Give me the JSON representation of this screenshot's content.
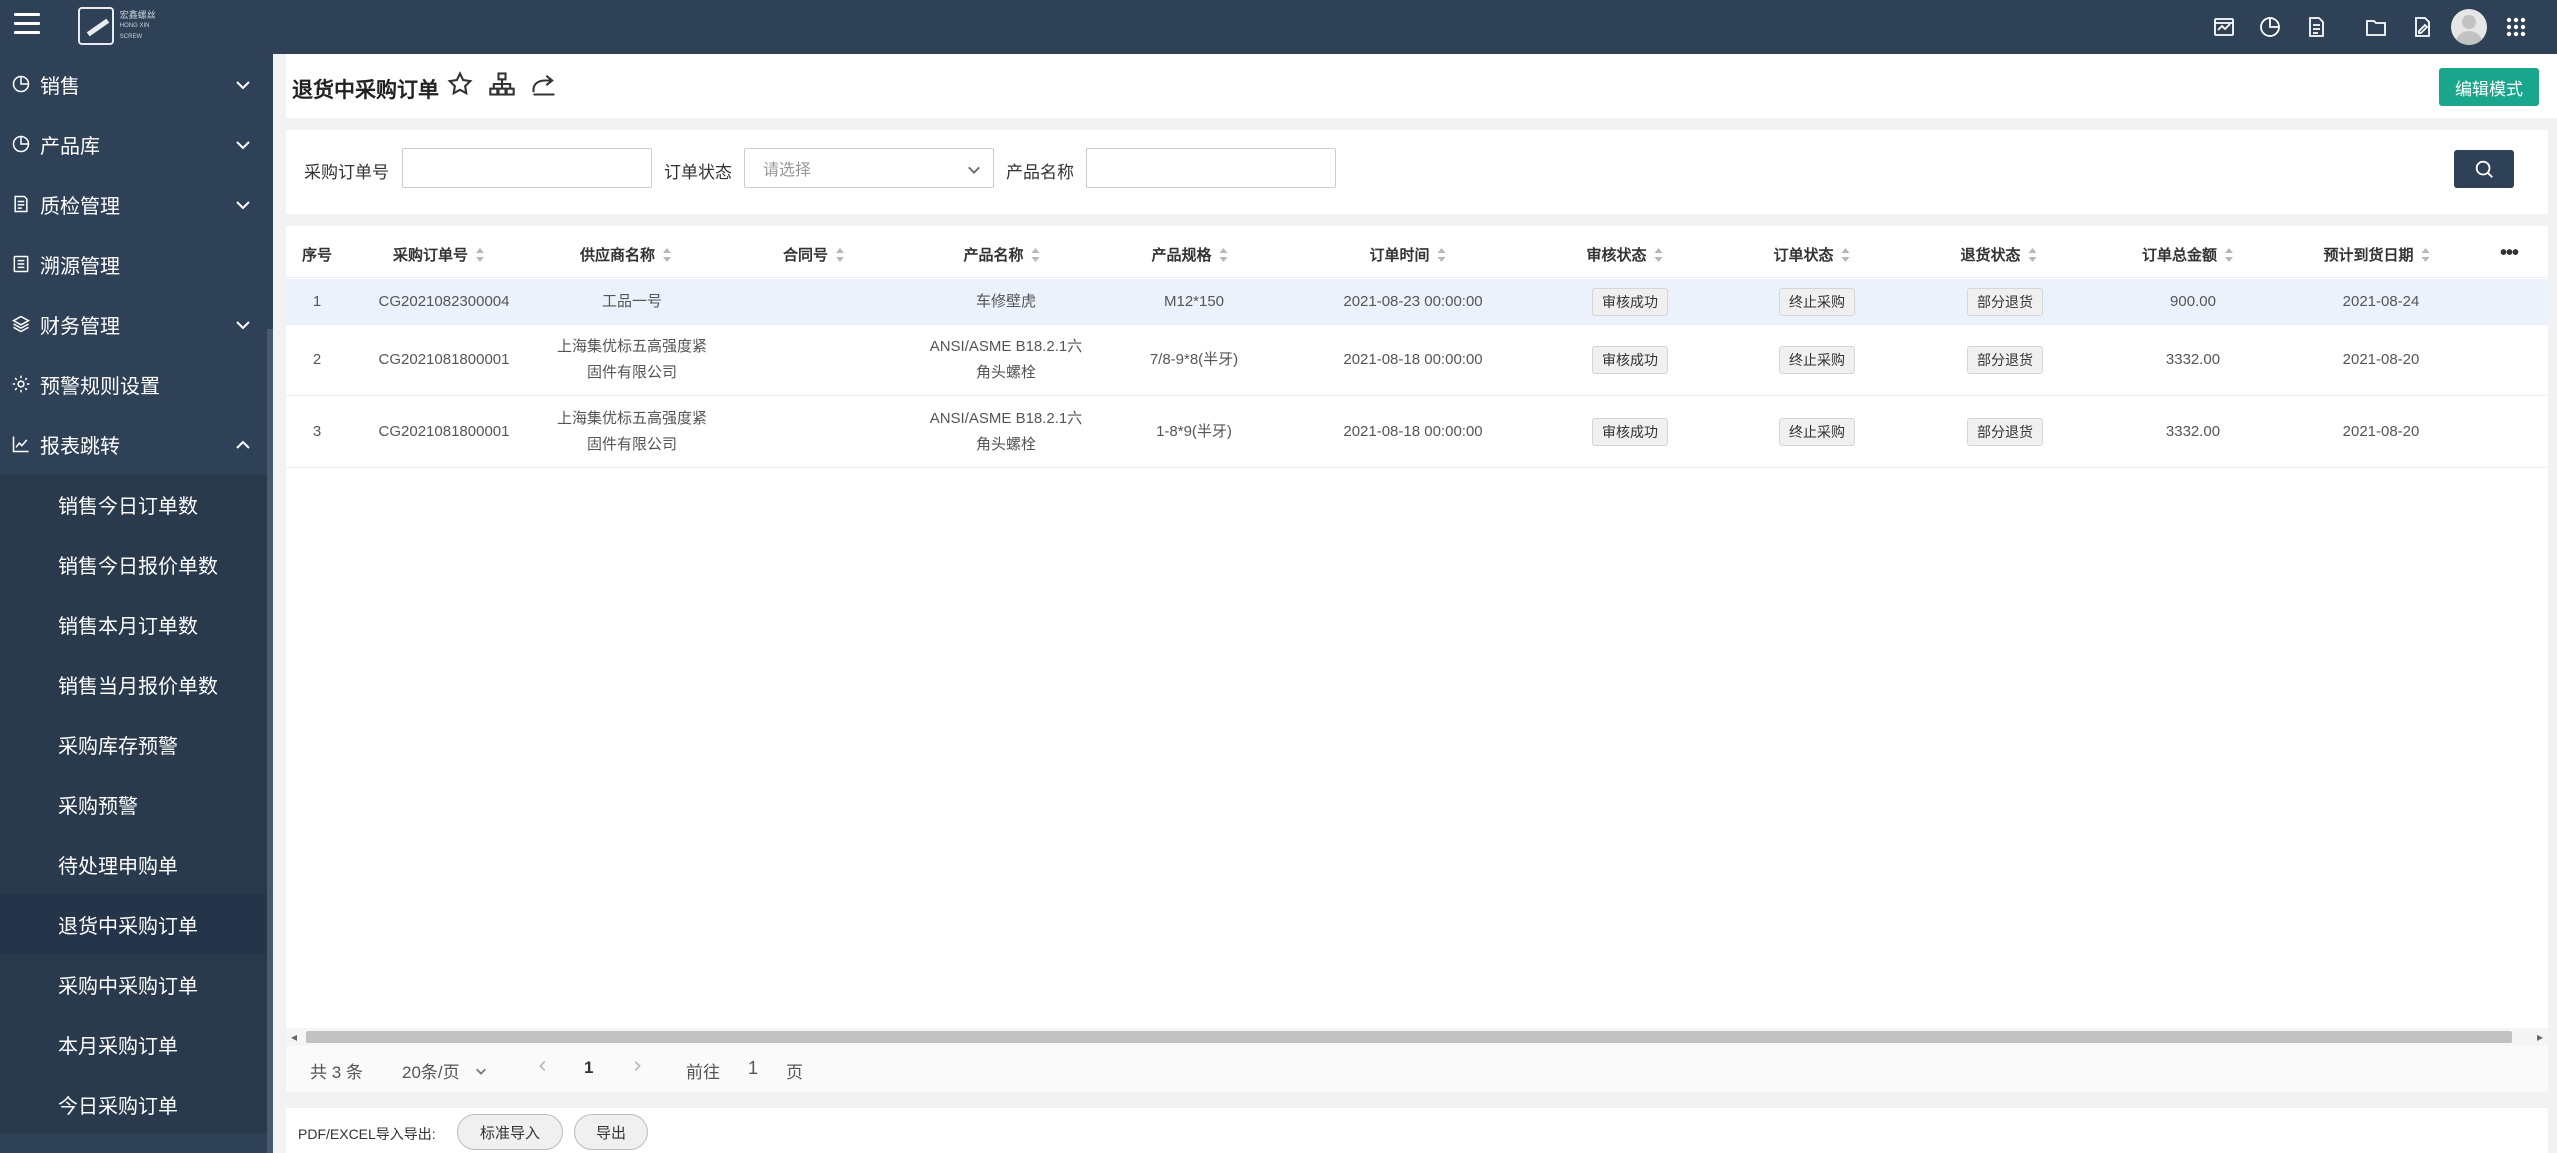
{
  "topbar": {
    "logo_text_line1": "宏鑫螺丝",
    "logo_text_line2": "HONG XIN SCREW",
    "icons": [
      "dashboard-icon",
      "pie-chart-icon",
      "document-icon",
      "folder-icon",
      "edit-document-icon",
      "user-avatar",
      "apps-grid-icon"
    ]
  },
  "sidebar": {
    "top_items": [
      {
        "label": "销售",
        "icon": "pie-chart-icon",
        "expandable": true
      },
      {
        "label": "产品库",
        "icon": "pie-chart-icon",
        "expandable": true
      },
      {
        "label": "质检管理",
        "icon": "document-edit-icon",
        "expandable": true
      },
      {
        "label": "溯源管理",
        "icon": "list-document-icon",
        "expandable": false
      },
      {
        "label": "财务管理",
        "icon": "layers-icon",
        "expandable": true
      },
      {
        "label": "预警规则设置",
        "icon": "gear-icon",
        "expandable": false
      },
      {
        "label": "报表跳转",
        "icon": "line-chart-icon",
        "expandable": true,
        "expanded": true
      }
    ],
    "sub_items": [
      {
        "label": "销售今日订单数"
      },
      {
        "label": "销售今日报价单数"
      },
      {
        "label": "销售本月订单数"
      },
      {
        "label": "销售当月报价单数"
      },
      {
        "label": "采购库存预警"
      },
      {
        "label": "采购预警"
      },
      {
        "label": "待处理申购单"
      },
      {
        "label": "退货中采购订单",
        "active": true
      },
      {
        "label": "采购中采购订单"
      },
      {
        "label": "本月采购订单"
      },
      {
        "label": "今日采购订单"
      }
    ]
  },
  "header": {
    "title": "退货中采购订单",
    "edit_button": "编辑模式"
  },
  "filters": {
    "order_no_label": "采购订单号",
    "order_no_value": "",
    "status_label": "订单状态",
    "status_placeholder": "请选择",
    "product_label": "产品名称",
    "product_value": ""
  },
  "table": {
    "columns": [
      "序号",
      "采购订单号",
      "供应商名称",
      "合同号",
      "产品名称",
      "产品规格",
      "订单时间",
      "审核状态",
      "订单状态",
      "退货状态",
      "订单总金额",
      "预计到货日期"
    ],
    "rows": [
      {
        "no": "1",
        "order_no": "CG2021082300004",
        "supplier_l1": "工品一号",
        "supplier_l2": "",
        "contract": "",
        "product_l1": "车修壁虎",
        "product_l2": "",
        "spec": "M12*150",
        "time": "2021-08-23 00:00:00",
        "audit": "审核成功",
        "status": "终止采购",
        "return": "部分退货",
        "amount": "900.00",
        "eta": "2021-08-24"
      },
      {
        "no": "2",
        "order_no": "CG2021081800001",
        "supplier_l1": "上海集优标五高强度紧",
        "supplier_l2": "固件有限公司",
        "contract": "",
        "product_l1": "ANSI/ASME B18.2.1六",
        "product_l2": "角头螺栓",
        "spec": "7/8-9*8(半牙)",
        "time": "2021-08-18 00:00:00",
        "audit": "审核成功",
        "status": "终止采购",
        "return": "部分退货",
        "amount": "3332.00",
        "eta": "2021-08-20"
      },
      {
        "no": "3",
        "order_no": "CG2021081800001",
        "supplier_l1": "上海集优标五高强度紧",
        "supplier_l2": "固件有限公司",
        "contract": "",
        "product_l1": "ANSI/ASME B18.2.1六",
        "product_l2": "角头螺栓",
        "spec": "1-8*9(半牙)",
        "time": "2021-08-18 00:00:00",
        "audit": "审核成功",
        "status": "终止采购",
        "return": "部分退货",
        "amount": "3332.00",
        "eta": "2021-08-20"
      }
    ]
  },
  "pagination": {
    "total": "共 3 条",
    "page_size": "20条/页",
    "current_page": "1",
    "goto_label": "前往",
    "goto_value": "1",
    "page_suffix": "页"
  },
  "footer": {
    "label": "PDF/EXCEL导入导出:",
    "import_button": "标准导入",
    "export_button": "导出"
  },
  "colors": {
    "sidebar_bg": "#2f4156",
    "accent_green": "#1aa68d",
    "row_highlight": "#ecf2fb"
  }
}
